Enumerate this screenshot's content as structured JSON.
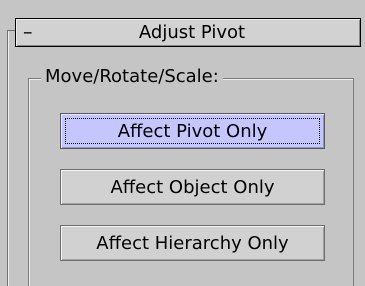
{
  "rollout": {
    "collapse_symbol": "–",
    "title": "Adjust Pivot"
  },
  "group": {
    "label": "Move/Rotate/Scale:"
  },
  "buttons": {
    "affect_pivot_only": "Affect Pivot Only",
    "affect_object_only": "Affect Object Only",
    "affect_hierarchy_only": "Affect Hierarchy Only"
  },
  "state": {
    "active_button": "Affect Pivot Only"
  },
  "colors": {
    "panel_background": "#c5c5c5",
    "button_face": "#d1d1d1",
    "active_button_face": "#c6c6ff"
  }
}
